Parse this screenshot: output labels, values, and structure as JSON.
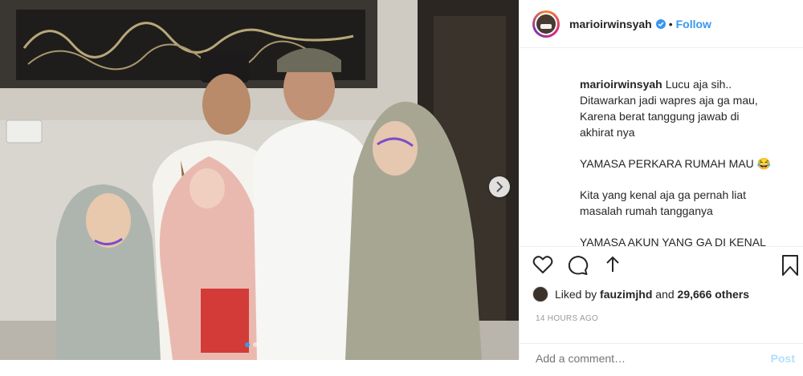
{
  "post": {
    "username": "marioirwinsyah",
    "follow_label": "Follow",
    "separator": "•",
    "caption_lines": [
      "Lucu aja sih..",
      "Ditawarkan jadi wapres aja ga mau,",
      "Karena berat tanggung jawab di",
      "akhirat nya"
    ],
    "caption_p2": "YAMASA PERKARA RUMAH MAU 😂",
    "caption_p3a": "Kita yang kenal aja ga pernah liat",
    "caption_p3b": "masalah rumah tangganya",
    "caption_p4": "YAMASA AKUN YANG GA DI KENAL",
    "likes_prefix": "Liked by",
    "likes_user": "fauzimjhd",
    "likes_and": "and",
    "likes_count": "29,666 others",
    "timestamp": "14 HOURS AGO",
    "comment_placeholder": "Add a comment…",
    "post_label": "Post"
  },
  "carousel": {
    "total": 2,
    "active": 1
  },
  "colors": {
    "link": "#3897f0",
    "verified": "#3897f0",
    "muted": "#999999"
  },
  "icons": [
    "verified-badge-icon",
    "heart-icon",
    "comment-icon",
    "share-icon",
    "bookmark-icon",
    "chevron-right-icon"
  ]
}
